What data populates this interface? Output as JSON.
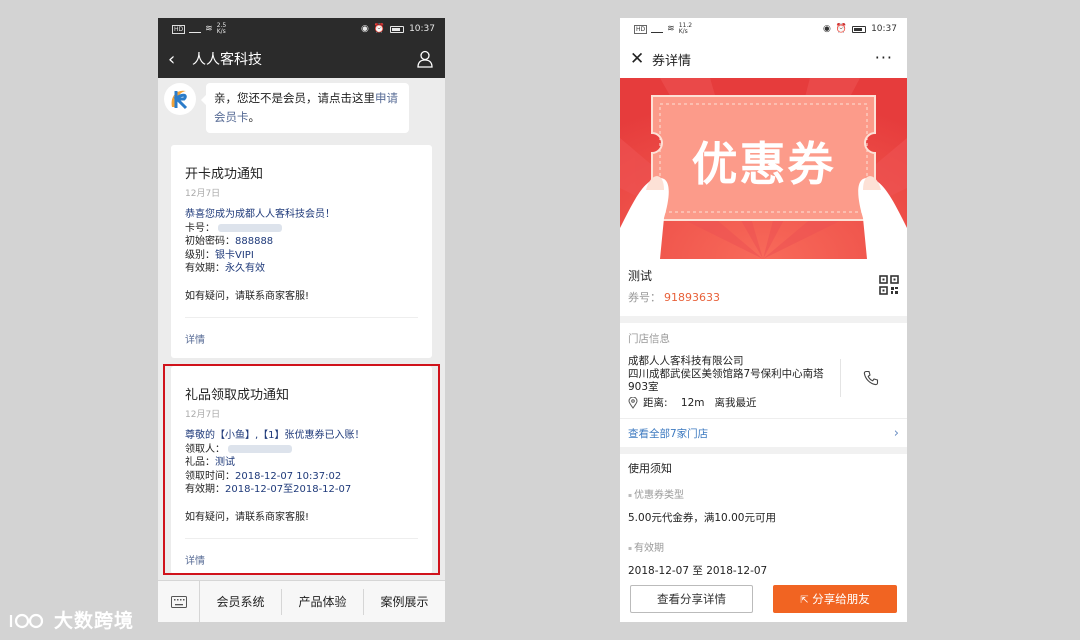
{
  "left_phone": {
    "status": {
      "speed": "2.5\nK/s",
      "time": "10:37"
    },
    "header": {
      "back_icon": "chevron-left-icon",
      "title": "人人客科技",
      "profile_icon": "user-icon"
    },
    "bubble": {
      "text_pre": "亲，您还不是会员，请点击这里",
      "link_a": "申",
      "link_b": "请会员卡",
      "text_post": "。"
    },
    "card1": {
      "title": "开卡成功通知",
      "date": "12月7日",
      "greeting": "恭喜您成为成都人人客科技会员！",
      "card_no_label": "卡号：",
      "pwd_label": "初始密码：",
      "pwd_value": "888888",
      "level_label": "级别：",
      "level_value": "银卡VIPI",
      "validity_label": "有效期：",
      "validity_value": "永久有效",
      "contact": "如有疑问，请联系商家客服!",
      "detail": "详情"
    },
    "card2": {
      "title": "礼品领取成功通知",
      "date": "12月7日",
      "greeting": "尊敬的【小鱼】,【1】张优惠券已入账！",
      "receiver_label": "领取人：",
      "gift_label": "礼品：",
      "gift_value": "测试",
      "time_label": "领取时间：",
      "time_value": "2018-12-07 10:37:02",
      "validity_label": "有效期：",
      "validity_value": "2018-12-07至2018-12-07",
      "contact": "如有疑问，请联系商家客服!",
      "detail": "详情"
    },
    "menu": {
      "keyboard_icon": "keyboard-icon",
      "items": [
        "会员系统",
        "产品体验",
        "案例展示"
      ]
    }
  },
  "right_phone": {
    "status": {
      "speed": "11.2\nK/s",
      "time": "10:37"
    },
    "header": {
      "close_icon": "close-icon",
      "title": "券详情",
      "more_icon": "more-icon",
      "more_text": "···"
    },
    "banner": {
      "text": "优惠券"
    },
    "coupon": {
      "name": "测试",
      "code_label": "券号：",
      "code_value": "91893633",
      "qr_icon": "qr-code-icon"
    },
    "store": {
      "heading": "门店信息",
      "name": "成都人人客科技有限公司",
      "address": "四川成都武侯区美领馆路7号保利中心南塔903室",
      "distance": "距离:    12m   离我最近",
      "phone_icon": "phone-icon",
      "all_stores": "查看全部7家门店",
      "chevron": "›"
    },
    "usage": {
      "title": "使用须知",
      "type_label": "优惠券类型",
      "type_value": "5.00元代金券，满10.00元可用",
      "validity_label": "有效期",
      "validity_value": "2018-12-07 至 2018-12-07"
    },
    "footer": {
      "view_label": "查看分享详情",
      "share_label": "分享给朋友"
    }
  },
  "watermark": {
    "text": "大数跨境"
  },
  "colors": {
    "wechat_dark": "#2b2b2b",
    "highlight_red": "#d0121b",
    "link_blue": "#576b95",
    "banner_red": "#e94949",
    "code_orange": "#e8613a",
    "share_orange": "#f16422"
  }
}
